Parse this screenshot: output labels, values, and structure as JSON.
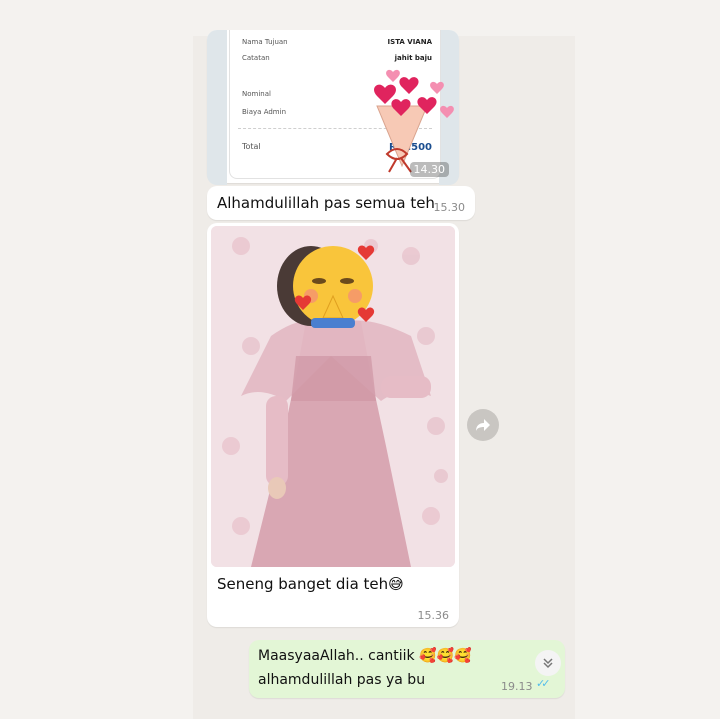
{
  "receipt": {
    "rows": [
      {
        "key": "Nama Tujuan",
        "value": "ISTA VIANA"
      },
      {
        "key": "Catatan",
        "value": "jahit baju"
      },
      {
        "key": "Nominal",
        "value": ""
      },
      {
        "key": "Biaya Admin",
        "value": ""
      },
      {
        "key": "Total",
        "value": "Rp .500"
      }
    ],
    "time": "14.30"
  },
  "messages": [
    {
      "text": "Alhamdulillah pas semua teh",
      "time": "15.30"
    },
    {
      "text": "Seneng banget dia teh😅",
      "time": "15.36"
    },
    {
      "text_line1": "MaasyaaAllah.. cantiik 🥰🥰🥰",
      "text_line2": "alhamdulillah pas ya bu",
      "time": "19.13",
      "ticks": "✓✓"
    }
  ],
  "icons": {
    "forward": "forward-arrow-icon",
    "chevron": "chevron-down-icon"
  },
  "colors": {
    "incoming_bubble": "#ffffff",
    "outgoing_bubble": "#e3f6d6",
    "read_ticks": "#53bdeb"
  }
}
